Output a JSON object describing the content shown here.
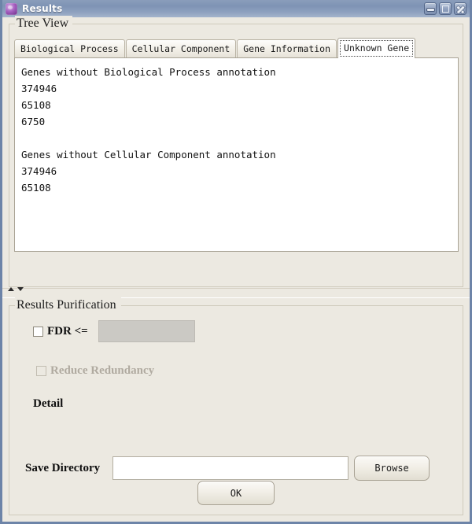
{
  "window": {
    "title": "Results",
    "icon": "app-icon",
    "controls": [
      {
        "name": "minimize",
        "glyph": "minimize-icon"
      },
      {
        "name": "maximize",
        "glyph": "maximize-icon"
      },
      {
        "name": "close",
        "glyph": "close-icon"
      }
    ]
  },
  "tree_view": {
    "group_title": "Tree View",
    "tabs": [
      {
        "label": "Biological Process",
        "active": false
      },
      {
        "label": "Cellular Component",
        "active": false
      },
      {
        "label": "Gene Information",
        "active": false
      },
      {
        "label": "Unknown Gene",
        "active": true
      }
    ],
    "content": "Genes without Biological Process annotation\n374946\n65108\n6750\n\nGenes without Cellular Component annotation\n374946\n65108"
  },
  "divider": {
    "collapse_up": "collapse-up-arrow",
    "collapse_down": "collapse-down-arrow"
  },
  "purification": {
    "group_title": "Results Purification",
    "fdr": {
      "label": "FDR <=",
      "checked": false,
      "value": "",
      "enabled": false
    },
    "reduce_redundancy": {
      "label": "Reduce Redundancy",
      "checked": false,
      "enabled": false
    },
    "detail": {
      "label": "Detail"
    },
    "save_directory": {
      "label": "Save Directory",
      "value": "",
      "placeholder": "",
      "browse_label": "Browse"
    },
    "ok_label": "OK"
  },
  "colors": {
    "titlebar_start": "#8a9dbb",
    "titlebar_end": "#a4b4cc",
    "window_border": "#6d84a8",
    "panel_bg": "#ece9e1",
    "text_bg": "#ffffff",
    "disabled_field": "#cbc9c4",
    "disabled_text": "#b0aaa0"
  }
}
